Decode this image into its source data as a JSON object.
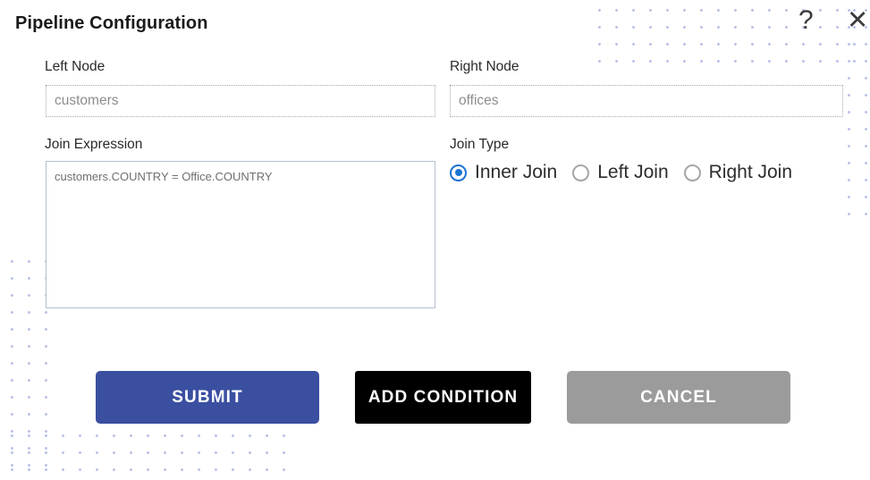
{
  "header": {
    "title": "Pipeline Configuration",
    "help_icon": "question-mark-icon",
    "help_glyph": "?",
    "close_icon": "close-icon",
    "close_glyph": "✕"
  },
  "form": {
    "left_node": {
      "label": "Left Node",
      "value": "",
      "placeholder": "customers"
    },
    "right_node": {
      "label": "Right Node",
      "value": "",
      "placeholder": "offices"
    },
    "join_expression": {
      "label": "Join Expression",
      "value": "",
      "placeholder": "customers.COUNTRY = Office.COUNTRY"
    },
    "join_type": {
      "label": "Join Type",
      "selected": "Inner Join",
      "options": [
        {
          "label": "Inner Join",
          "checked": true
        },
        {
          "label": "Left Join",
          "checked": false
        },
        {
          "label": "Right Join",
          "checked": false
        }
      ]
    }
  },
  "actions": {
    "submit_label": "SUBMIT",
    "add_condition_label": "ADD CONDITION",
    "cancel_label": "CANCEL"
  },
  "colors": {
    "submit_bg": "#3a4fa0",
    "add_condition_bg": "#000000",
    "cancel_bg": "#9b9b9b",
    "radio_accent": "#1975d2",
    "dot_pattern": "#b9c0e8",
    "title_text": "#1b1b1b"
  }
}
